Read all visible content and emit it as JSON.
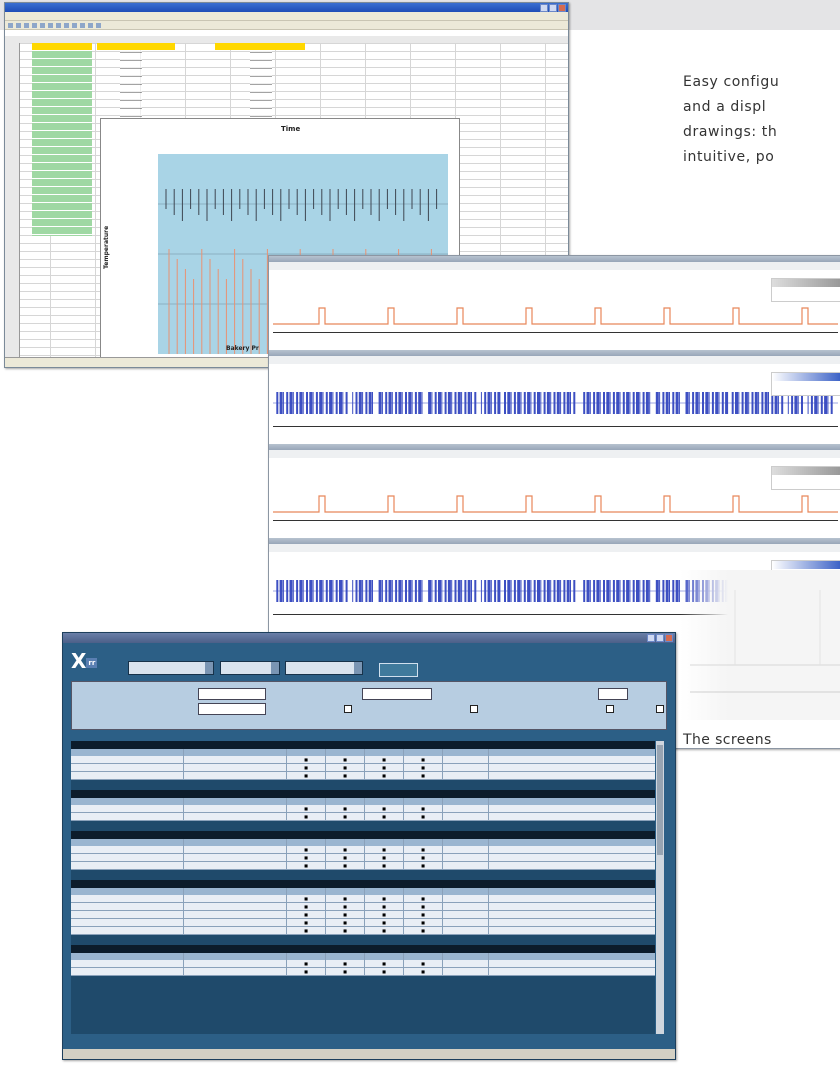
{
  "copy": {
    "lines": [
      "Easy configu",
      "and a displ",
      "drawings: th",
      "intuitive, po"
    ],
    "screens_line": "The screens"
  },
  "spreadsheet": {
    "chart_title": "Time",
    "y_axis_label": "Temperature",
    "x_axis_label": "Bakery Pr"
  },
  "trends": {
    "panels": [
      {
        "color": "#e8875a",
        "style": "pulse"
      },
      {
        "color": "#3d4fc2",
        "style": "dense"
      },
      {
        "color": "#e8875a",
        "style": "pulse"
      },
      {
        "color": "#3d4fc2",
        "style": "dense"
      }
    ]
  },
  "config": {
    "accent": "#2c5f86",
    "sections": [
      {
        "rows": 3
      },
      {
        "rows": 2
      },
      {
        "rows": 3
      },
      {
        "rows": 5
      },
      {
        "rows": 2
      }
    ]
  }
}
